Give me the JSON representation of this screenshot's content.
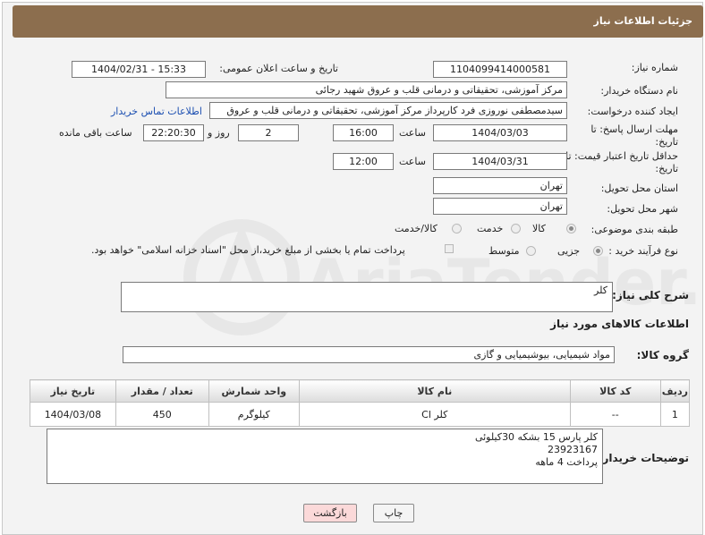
{
  "header": {
    "title": "جزئیات اطلاعات نیاز"
  },
  "form": {
    "need_number_label": "شماره نیاز:",
    "need_number": "1104099414000581",
    "announce_label": "تاریخ و ساعت اعلان عمومی:",
    "announce_value": "1404/02/31 - 15:33",
    "buyer_org_label": "نام دستگاه خریدار:",
    "buyer_org": "مرکز آموزشی، تحقیقاتی و درمانی قلب و عروق شهید رجائی",
    "requester_label": "ایجاد کننده درخواست:",
    "requester": "سیدمصطفی نوروزی فرد کارپرداز مرکز آموزشی، تحقیقاتی و درمانی قلب و عروق",
    "contact_link": "اطلاعات تماس خریدار",
    "deadline_label": "مهلت ارسال پاسخ: تا تاریخ:",
    "deadline_date": "1404/03/03",
    "time_label": "ساعت",
    "deadline_time": "16:00",
    "days_value": "2",
    "days_label": "روز و",
    "remaining_time": "22:20:30",
    "remaining_label": "ساعت باقی مانده",
    "validity_label": "حداقل تاریخ اعتبار قیمت: تا تاریخ:",
    "validity_date": "1404/03/31",
    "validity_time": "12:00",
    "province_label": "استان محل تحویل:",
    "province": "تهران",
    "city_label": "شهر محل تحویل:",
    "city": "تهران",
    "category_label": "طبقه بندی موضوعی:",
    "category_options": [
      "کالا",
      "خدمت",
      "کالا/خدمت"
    ],
    "category_selected": "کالا",
    "process_label": "نوع فرآیند خرید :",
    "process_options": [
      "جزیی",
      "متوسط"
    ],
    "process_selected": "جزیی",
    "payment_note": "پرداخت تمام یا بخشی از مبلغ خرید،از محل \"اسناد خزانه اسلامی\" خواهد بود.",
    "summary_label": "شرح کلی نیاز:",
    "summary_value": "کلر",
    "goods_info_title": "اطلاعات کالاهای مورد نیاز",
    "goods_group_label": "گروه کالا:",
    "goods_group": "مواد شیمیایی، بیوشیمیایی و  گازی",
    "buyer_notes_label": "توضیحات خریدار:",
    "buyer_notes": [
      "کلر پارس 15 بشکه 30کیلوئی",
      "23923167",
      "پرداخت 4 ماهه"
    ]
  },
  "table": {
    "headers": [
      "ردیف",
      "کد کالا",
      "نام کالا",
      "واحد شمارش",
      "تعداد / مقدار",
      "تاریخ نیاز"
    ],
    "rows": [
      [
        "1",
        "--",
        "کلر Cl",
        "کیلوگرم",
        "450",
        "1404/03/08"
      ]
    ]
  },
  "buttons": {
    "print": "چاپ",
    "back": "بازگشت"
  },
  "watermark": "AriaTender.neT"
}
